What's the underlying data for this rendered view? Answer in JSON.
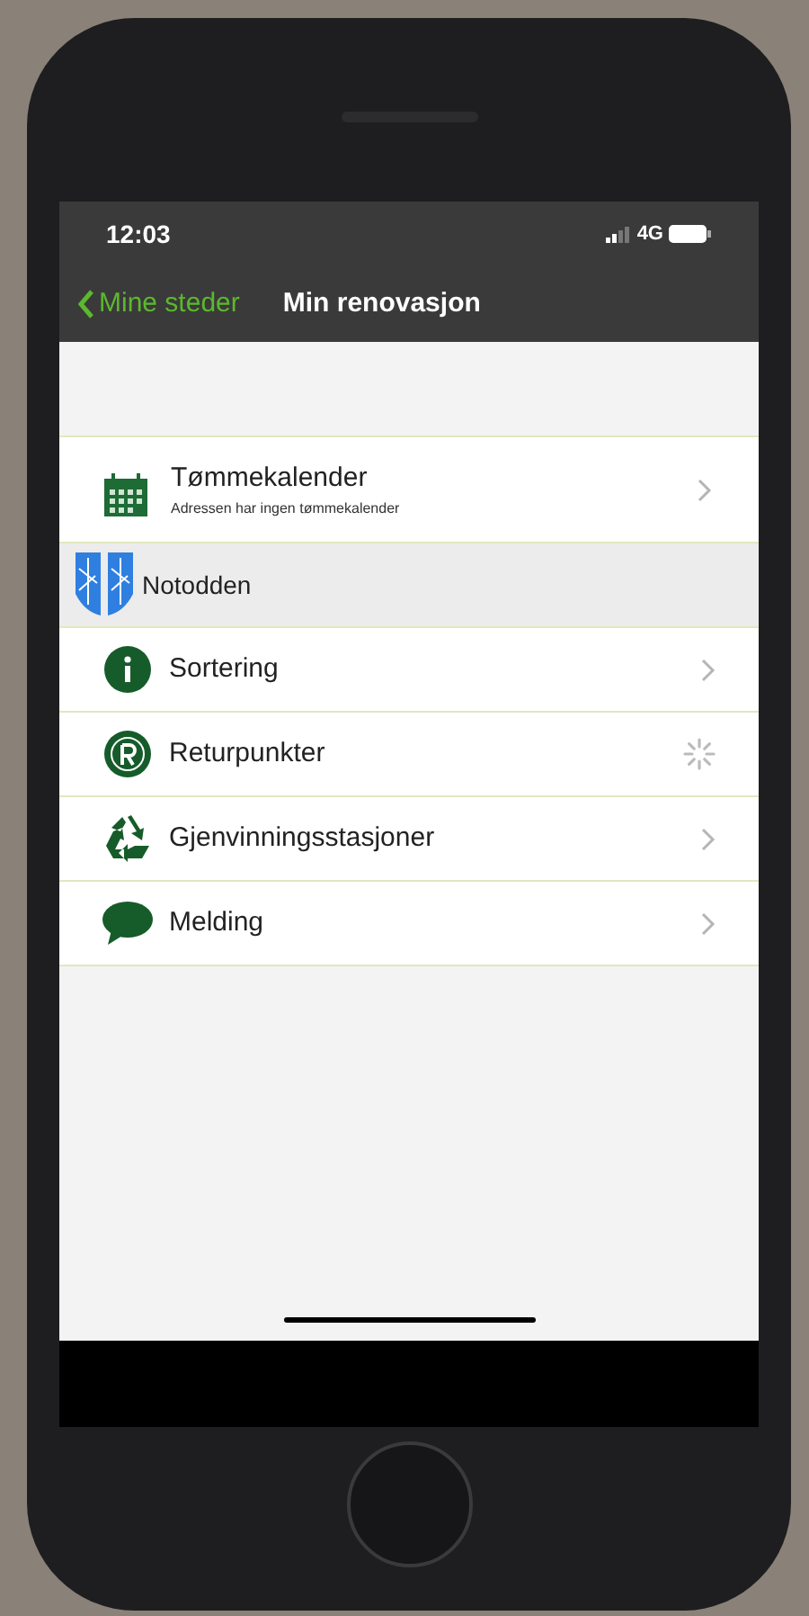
{
  "status_bar": {
    "time": "12:03",
    "network": "4G"
  },
  "nav_bar": {
    "back": "Mine steder",
    "title": "Min renovasjon"
  },
  "calendar": {
    "kind": "calendar",
    "title": "Tømmekalender",
    "subtitle": "Adressen har ingen tømmekalender"
  },
  "municipality": {
    "name": "Notodden"
  },
  "items": [
    {
      "kind": "info",
      "label": "Sortering",
      "loading": false
    },
    {
      "kind": "return",
      "label": "Returpunkter",
      "loading": true
    },
    {
      "kind": "recycle",
      "label": "Gjenvinningsstasjoner",
      "loading": false
    },
    {
      "kind": "message",
      "label": "Melding",
      "loading": false
    }
  ]
}
